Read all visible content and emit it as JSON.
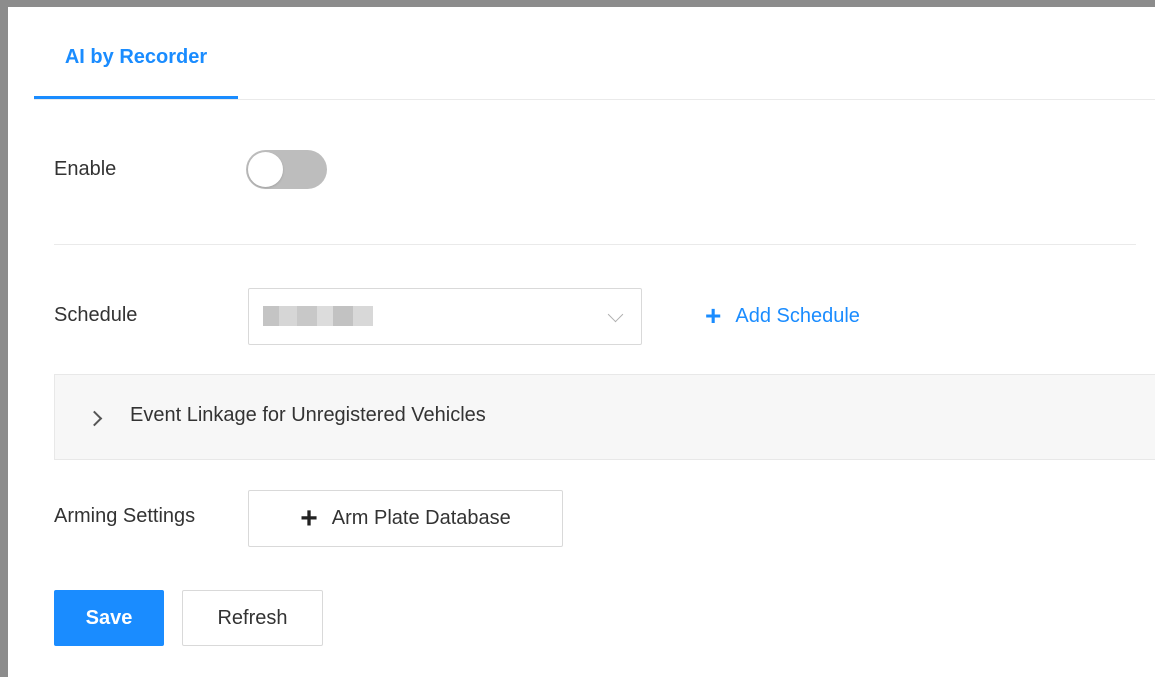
{
  "tabs": [
    {
      "label": "AI by Recorder",
      "active": true
    }
  ],
  "enable": {
    "label": "Enable",
    "state": false
  },
  "schedule": {
    "label": "Schedule",
    "value": "",
    "value_obscured": true,
    "add_label": "Add Schedule"
  },
  "event_linkage": {
    "title": "Event Linkage for Unregistered Vehicles",
    "expanded": false
  },
  "arming": {
    "label": "Arming Settings",
    "button_label": "Arm Plate Database"
  },
  "actions": {
    "save_label": "Save",
    "refresh_label": "Refresh"
  },
  "icons": {
    "add": "plus-icon",
    "expand": "chevron-right-icon",
    "dropdown": "chevron-down-icon"
  },
  "colors": {
    "accent": "#1a8cff",
    "toggle_off": "#bdbdbd",
    "panel_bg": "#f7f7f7"
  }
}
